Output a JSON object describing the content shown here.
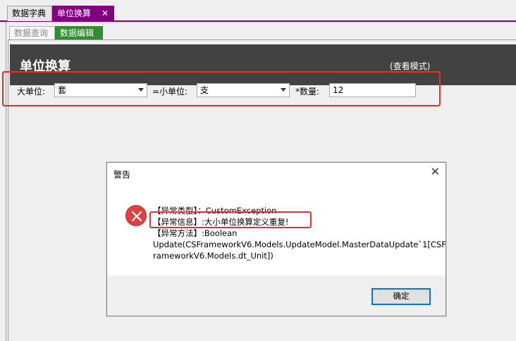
{
  "tabs": {
    "items": [
      {
        "label": "数据字典"
      },
      {
        "label": "单位换算"
      }
    ],
    "close_glyph": "✕"
  },
  "subtabs": {
    "items": [
      {
        "label": "数据查询"
      },
      {
        "label": "数据编辑"
      }
    ]
  },
  "header": {
    "title": "单位换算",
    "mode": "(查看模式)"
  },
  "form": {
    "big_unit_label": "大单位:",
    "big_unit_value": "套",
    "small_unit_label": "=小单位:",
    "small_unit_value": "支",
    "qty_label": "*数量:",
    "qty_value": "12"
  },
  "dialog": {
    "title": "警告",
    "close_glyph": "✕",
    "lines": [
      "【异常类型】：CustomException",
      "【异常信息】:大小单位换算定义重复!",
      "【异常方法】:Boolean",
      "Update(CSFrameworkV6.Models.UpdateModel.MasterDataUpdate`1[CSF",
      "rameworkV6.Models.dt_Unit])"
    ],
    "ok_label": "确定"
  },
  "colors": {
    "tab_active": "#800080",
    "subtab_active": "#2f8f2f",
    "header_bg": "#424242",
    "highlight": "#e53030",
    "error_icon": "#e04040",
    "focus_border": "#0078d7"
  }
}
